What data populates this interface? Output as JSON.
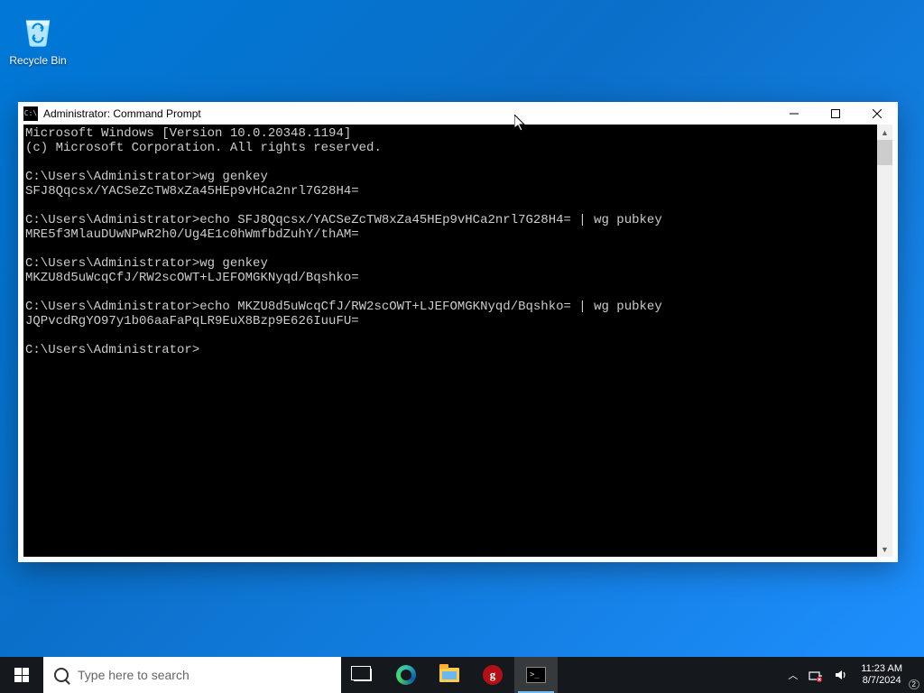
{
  "desktop": {
    "recycle_bin_label": "Recycle Bin"
  },
  "cmd": {
    "title": "Administrator: Command Prompt",
    "lines": [
      "Microsoft Windows [Version 10.0.20348.1194]",
      "(c) Microsoft Corporation. All rights reserved.",
      "",
      "C:\\Users\\Administrator>wg genkey",
      "SFJ8Qqcsx/YACSeZcTW8xZa45HEp9vHCa2nrl7G28H4=",
      "",
      "C:\\Users\\Administrator>echo SFJ8Qqcsx/YACSeZcTW8xZa45HEp9vHCa2nrl7G28H4= | wg pubkey",
      "MRE5f3MlauDUwNPwR2h0/Ug4E1c0hWmfbdZuhY/thAM=",
      "",
      "C:\\Users\\Administrator>wg genkey",
      "MKZU8d5uWcqCfJ/RW2scOWT+LJEFOMGKNyqd/Bqshko=",
      "",
      "C:\\Users\\Administrator>echo MKZU8d5uWcqCfJ/RW2scOWT+LJEFOMGKNyqd/Bqshko= | wg pubkey",
      "JQPvcdRgYO97y1b06aaFaPqLR9EuX8Bzp9E626IuuFU=",
      "",
      "C:\\Users\\Administrator>"
    ]
  },
  "taskbar": {
    "search_placeholder": "Type here to search",
    "clock_time": "11:23 AM",
    "clock_date": "8/7/2024",
    "notif_count": "2"
  }
}
